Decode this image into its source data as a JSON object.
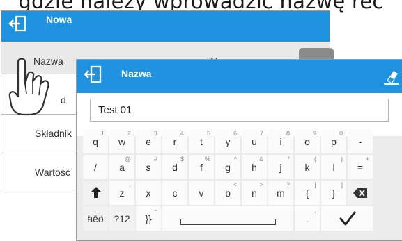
{
  "page": {
    "top_text": "gdzie należy wprowadzić nazwę rec"
  },
  "back_window": {
    "title": "Nowa",
    "rows": [
      {
        "label": "Nazwa",
        "value": "Nowa"
      },
      {
        "label": "d"
      },
      {
        "label": "Składnik"
      },
      {
        "label": "Wartość"
      }
    ]
  },
  "dialog": {
    "title": "Nazwa",
    "input_value": "Test 01",
    "keys": [
      {
        "id": "q",
        "main": "q",
        "alt": "1"
      },
      {
        "id": "w",
        "main": "w",
        "alt": "2"
      },
      {
        "id": "e",
        "main": "e",
        "alt": "3"
      },
      {
        "id": "r",
        "main": "r",
        "alt": "4"
      },
      {
        "id": "t",
        "main": "t",
        "alt": "5"
      },
      {
        "id": "y",
        "main": "y",
        "alt": "6"
      },
      {
        "id": "u",
        "main": "u",
        "alt": "7"
      },
      {
        "id": "i",
        "main": "i",
        "alt": "8"
      },
      {
        "id": "o",
        "main": "o",
        "alt": "9"
      },
      {
        "id": "p",
        "main": "p",
        "alt": "0"
      },
      {
        "id": "dash",
        "main": "-",
        "alt": ""
      },
      {
        "id": "slash",
        "main": "/",
        "alt": ""
      },
      {
        "id": "a",
        "main": "a",
        "alt": "@"
      },
      {
        "id": "s",
        "main": "s",
        "alt": "#"
      },
      {
        "id": "d",
        "main": "d",
        "alt": "$"
      },
      {
        "id": "f",
        "main": "f",
        "alt": "%"
      },
      {
        "id": "g",
        "main": "g",
        "alt": "^"
      },
      {
        "id": "h",
        "main": "h",
        "alt": "&"
      },
      {
        "id": "j",
        "main": "j",
        "alt": "*"
      },
      {
        "id": "k",
        "main": "k",
        "alt": "("
      },
      {
        "id": "l",
        "main": "l",
        "alt": ")"
      },
      {
        "id": "equals",
        "main": "=",
        "alt": "+"
      },
      {
        "id": "z",
        "main": "z",
        "alt": "."
      },
      {
        "id": "x",
        "main": "x",
        "alt": ""
      },
      {
        "id": "c",
        "main": "c",
        "alt": ""
      },
      {
        "id": "v",
        "main": "v",
        "alt": ""
      },
      {
        "id": "b",
        "main": "b",
        "alt": "<"
      },
      {
        "id": "n",
        "main": "n",
        "alt": ">"
      },
      {
        "id": "m",
        "main": "m",
        "alt": "?"
      },
      {
        "id": "lbrace",
        "main": "{",
        "alt": "["
      },
      {
        "id": "rbrace",
        "main": "}",
        "alt": "]"
      },
      {
        "id": "dot",
        "main": ".",
        "alt": ","
      },
      {
        "id": "accents",
        "main": "äēö",
        "alt": ""
      },
      {
        "id": "symbols",
        "main": "?12",
        "alt": ""
      },
      {
        "id": "brackets",
        "main": "}}",
        "alt": "~"
      }
    ]
  }
}
